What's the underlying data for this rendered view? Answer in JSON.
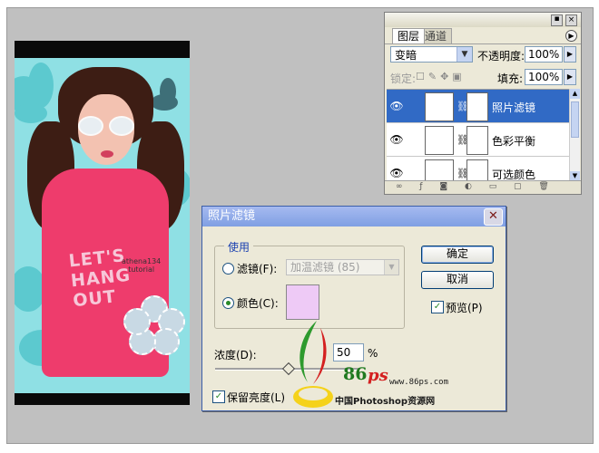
{
  "layers_panel": {
    "tabs": [
      "图层",
      "通道"
    ],
    "blend_mode": "变暗",
    "opacity_label": "不透明度:",
    "opacity_value": "100%",
    "lock_label": "锁定:",
    "fill_label": "填充:",
    "fill_value": "100%",
    "layers": [
      {
        "name": "照片滤镜",
        "selected": true
      },
      {
        "name": "色彩平衡",
        "selected": false
      },
      {
        "name": "可选颜色",
        "selected": false
      }
    ]
  },
  "dialog": {
    "title": "照片滤镜",
    "group_title": "使用",
    "filter_label": "滤镜(F):",
    "filter_value": "加温滤镜 (85)",
    "color_label": "颜色(C):",
    "color_swatch": "#eecaf6",
    "ok_label": "确定",
    "cancel_label": "取消",
    "preview_label": "预览(P)",
    "preview_checked": true,
    "density_label": "浓度(D):",
    "density_value": "50",
    "density_unit": "%",
    "preserve_label": "保留亮度(L)",
    "preserve_checked": true,
    "filter_mode_selected": "color"
  },
  "photo": {
    "shirt_text": [
      "LET'S",
      "HANG",
      "OUT"
    ],
    "watermark": [
      "athena134",
      "tutorial"
    ]
  },
  "logo": {
    "number": "86",
    "suffix": "ps",
    "url": "www.86ps.com",
    "caption": "中国Photoshop资源网"
  }
}
